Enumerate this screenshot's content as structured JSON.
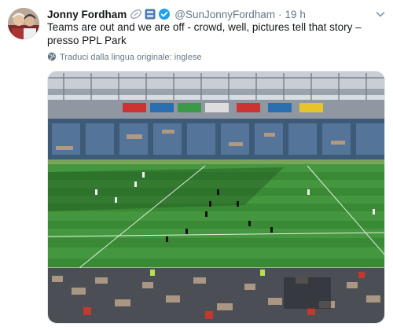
{
  "tweet": {
    "author_name": "Jonny Fordham",
    "handle": "@SunJonnyFordham",
    "separator": "·",
    "time": "19 h",
    "text_main": "Teams are out and we are off - crowd, well, pictures tell that story",
    "text_sep": " – presso ",
    "location": "PPL Park",
    "translation_note": "Traduci dalla lingua originale: inglese"
  },
  "icons": {
    "badge_1": "rugby-ball-icon",
    "badge_2": "app-badge-icon",
    "verified": "verified-icon",
    "more": "chevron-down-icon",
    "translate": "globe-icon"
  },
  "colors": {
    "name": "#14171a",
    "muted": "#657786",
    "verified": "#1da1f2",
    "pitch": "#3a8a35",
    "stands": "#3d5a78"
  }
}
